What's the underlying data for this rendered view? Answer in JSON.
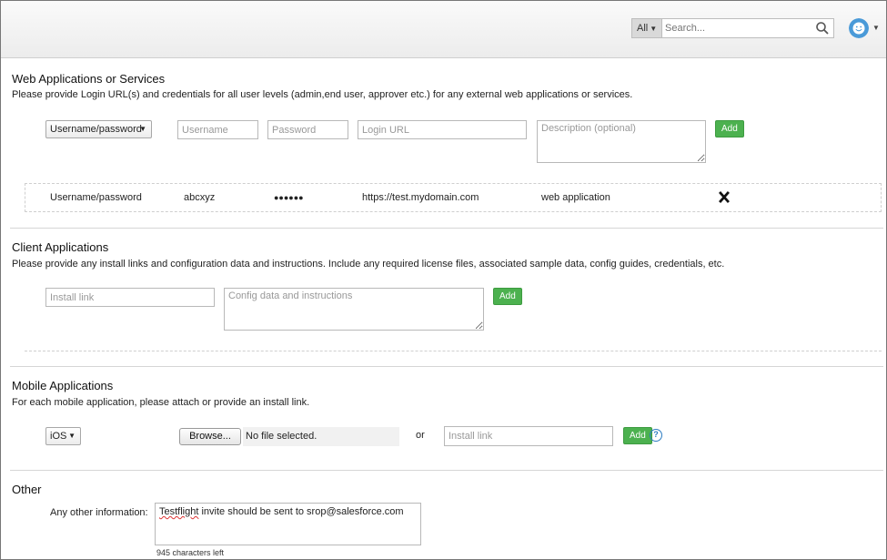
{
  "header": {
    "scope_label": "All",
    "search_placeholder": "Search...",
    "icons": {
      "search": "search-icon",
      "avatar": "smiley-avatar-icon",
      "caret": "chevron-down-icon"
    }
  },
  "web": {
    "title": "Web Applications or Services",
    "description": "Please provide Login URL(s) and credentials for all user levels (admin,end user, approver etc.) for any external web applications or services.",
    "auth_select": "Username/password",
    "username_placeholder": "Username",
    "password_placeholder": "Password",
    "login_url_placeholder": "Login URL",
    "description_placeholder": "Description (optional)",
    "add_label": "Add",
    "entry": {
      "auth_type": "Username/password",
      "username": "abcxyz",
      "password_mask": "●●●●●●",
      "url": "https://test.mydomain.com",
      "description": "web application",
      "delete_icon": "close-x-icon"
    }
  },
  "client": {
    "title": "Client Applications",
    "description": "Please provide any install links and configuration data and instructions. Include any required license files, associated sample data, config guides, credentials, etc.",
    "install_placeholder": "Install link",
    "config_placeholder": "Config data and instructions",
    "add_label": "Add"
  },
  "mobile": {
    "title": "Mobile Applications",
    "description": "For each mobile application, please attach or provide an install link.",
    "platform_select": "iOS",
    "browse_label": "Browse...",
    "file_status": "No file selected.",
    "or_label": "or",
    "install_placeholder": "Install link",
    "add_label": "Add",
    "help_icon": "question-icon"
  },
  "other": {
    "title": "Other",
    "field_label": "Any other information:",
    "value_word1": "Testflight",
    "value_rest": " invite should be sent to srop@salesforce.com",
    "chars_left": "945 characters left"
  }
}
